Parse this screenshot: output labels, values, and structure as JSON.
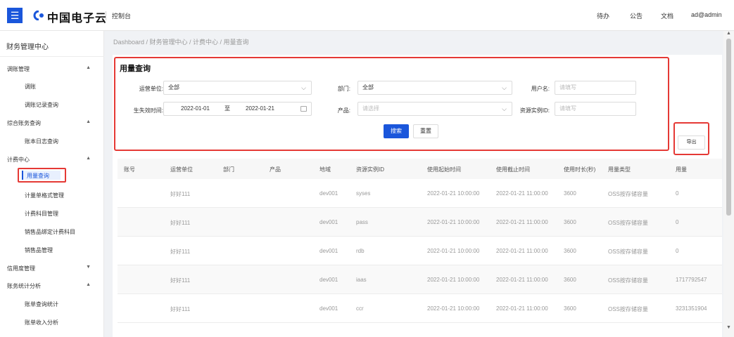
{
  "header": {
    "brand": "中国电子云",
    "console": "控制台",
    "links": [
      "待办",
      "公告",
      "文档",
      "ad@admin"
    ]
  },
  "sidebar": {
    "title": "财务管理中心",
    "groups": [
      {
        "label": "调账管理",
        "expanded": true,
        "items": [
          "调账",
          "调账记录查询"
        ]
      },
      {
        "label": "综合账务查询",
        "expanded": true,
        "items": [
          "账本日志查询"
        ]
      },
      {
        "label": "计费中心",
        "expanded": true,
        "items": [
          "用量查询",
          "计量单格式管理",
          "计费科目管理",
          "销售品绑定计费科目",
          "销售品管理"
        ]
      },
      {
        "label": "信用度管理",
        "expanded": false,
        "items": []
      },
      {
        "label": "账务统计分析",
        "expanded": true,
        "items": [
          "账单查询统计",
          "账单收入分析"
        ]
      }
    ],
    "active_item": "用量查询"
  },
  "breadcrumb": "Dashboard / 财务管理中心 / 计费中心 / 用量查询",
  "query": {
    "title": "用量查询",
    "operator_label": "运营单位:",
    "operator_value": "全部",
    "dept_label": "部门:",
    "dept_value": "全部",
    "user_label": "用户名:",
    "user_placeholder": "请填写",
    "time_label": "生失效时间:",
    "date_start": "2022-01-01",
    "date_to": "至",
    "date_end": "2022-01-21",
    "product_label": "产品:",
    "product_placeholder": "请选择",
    "instance_label": "资源实例ID:",
    "instance_placeholder": "请填写",
    "search_button": "搜索",
    "reset_button": "重置"
  },
  "export_button": "导出",
  "table": {
    "columns": [
      "账号",
      "运营单位",
      "部门",
      "产品",
      "地域",
      "资源实例ID",
      "使用起始时间",
      "使用截止时间",
      "使用时长(秒)",
      "用量类型",
      "用量"
    ],
    "rows": [
      [
        "",
        "好好111",
        "",
        "",
        "dev001",
        "syses",
        "2022-01-21 10:00:00",
        "2022-01-21 11:00:00",
        "3600",
        "OSS按存储容量",
        "0"
      ],
      [
        "",
        "好好111",
        "",
        "",
        "dev001",
        "pass",
        "2022-01-21 10:00:00",
        "2022-01-21 11:00:00",
        "3600",
        "OSS按存储容量",
        "0"
      ],
      [
        "",
        "好好111",
        "",
        "",
        "dev001",
        "rdb",
        "2022-01-21 10:00:00",
        "2022-01-21 11:00:00",
        "3600",
        "OSS按存储容量",
        "0"
      ],
      [
        "",
        "好好111",
        "",
        "",
        "dev001",
        "iaas",
        "2022-01-21 10:00:00",
        "2022-01-21 11:00:00",
        "3600",
        "OSS按存储容量",
        "1717792547"
      ],
      [
        "",
        "好好111",
        "",
        "",
        "dev001",
        "ccr",
        "2022-01-21 10:00:00",
        "2022-01-21 11:00:00",
        "3600",
        "OSS按存储容量",
        "3231351904"
      ]
    ]
  },
  "colors": {
    "primary": "#1a56db",
    "highlight": "#e53935"
  },
  "icons": [
    "menu-icon",
    "brand-logo-icon",
    "calendar-icon",
    "chevron-down-icon",
    "scroll-up-icon",
    "scroll-down-icon"
  ]
}
